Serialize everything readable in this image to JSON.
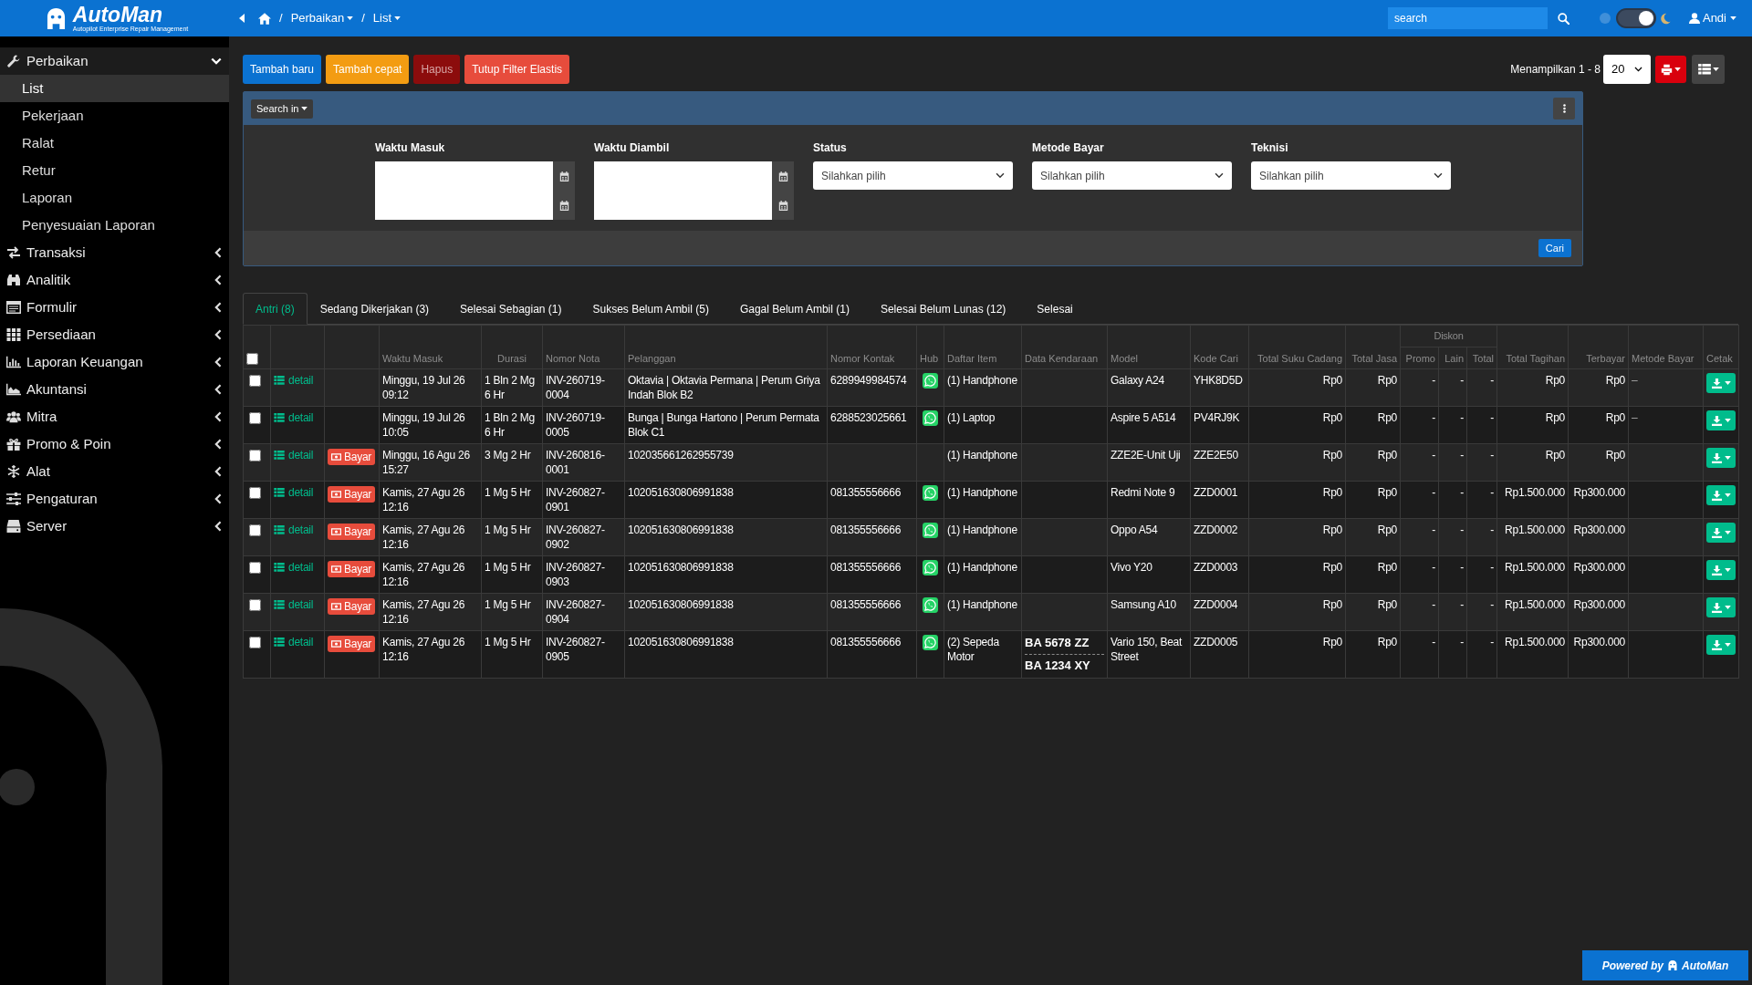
{
  "brand": {
    "name": "AutoMan",
    "tagline": "Autopilot Enterprise Repair Management"
  },
  "breadcrumb": [
    {
      "separator": "/",
      "label": "Perbaikan",
      "dropdown": true
    },
    {
      "separator": "/",
      "label": "List",
      "dropdown": true
    }
  ],
  "topbar": {
    "search": {
      "placeholder": "search"
    },
    "dark_mode": true,
    "user": "Andi"
  },
  "sidebar": {
    "items": [
      {
        "label": "Perbaikan",
        "expanded": true,
        "children": [
          {
            "label": "List",
            "selected": true
          },
          {
            "label": "Pekerjaan",
            "selected": false
          },
          {
            "label": "Ralat",
            "selected": false
          },
          {
            "label": "Retur",
            "selected": false
          },
          {
            "label": "Laporan",
            "selected": false
          },
          {
            "label": "Penyesuaian Laporan",
            "selected": false
          }
        ]
      },
      {
        "label": "Transaksi",
        "expanded": false
      },
      {
        "label": "Analitik",
        "expanded": false
      },
      {
        "label": "Formulir",
        "expanded": false
      },
      {
        "label": "Persediaan",
        "expanded": false
      },
      {
        "label": "Laporan Keuangan",
        "expanded": false
      },
      {
        "label": "Akuntansi",
        "expanded": false
      },
      {
        "label": "Mitra",
        "expanded": false
      },
      {
        "label": "Promo & Poin",
        "expanded": false
      },
      {
        "label": "Alat",
        "expanded": false
      },
      {
        "label": "Pengaturan",
        "expanded": false
      },
      {
        "label": "Server",
        "expanded": false
      }
    ]
  },
  "toolbar": {
    "buttons": [
      {
        "label": "Tambah baru",
        "kind": "primary",
        "disabled": false
      },
      {
        "label": "Tambah cepat",
        "kind": "warning",
        "disabled": false
      },
      {
        "label": "Hapus",
        "kind": "danger",
        "disabled": true
      },
      {
        "label": "Tutup Filter Elastis",
        "kind": "danger",
        "disabled": false
      }
    ],
    "summary": "Menampilkan 1 - 8",
    "page_size": "20"
  },
  "filter": {
    "search_in": "Search in",
    "fields": [
      {
        "label": "Waktu Masuk",
        "kind": "daterange"
      },
      {
        "label": "Waktu Diambil",
        "kind": "daterange"
      },
      {
        "label": "Status",
        "kind": "select",
        "placeholder": "Silahkan pilih"
      },
      {
        "label": "Metode Bayar",
        "kind": "select",
        "placeholder": "Silahkan pilih"
      },
      {
        "label": "Teknisi",
        "kind": "select",
        "placeholder": "Silahkan pilih"
      }
    ],
    "submit": "Cari"
  },
  "tabs": [
    {
      "label": "Antri (8)",
      "selected": true
    },
    {
      "label": "Sedang Dikerjakan (3)",
      "selected": false
    },
    {
      "label": "Selesai Sebagian (1)",
      "selected": false
    },
    {
      "label": "Sukses Belum Ambil (5)",
      "selected": false
    },
    {
      "label": "Gagal Belum Ambil (1)",
      "selected": false
    },
    {
      "label": "Selesai Belum Lunas (12)",
      "selected": false
    },
    {
      "label": "Selesai",
      "selected": false
    }
  ],
  "table": {
    "select_all": false,
    "columns": [
      {
        "label": "Waktu Masuk"
      },
      {
        "label": "Durasi"
      },
      {
        "label": "Nomor Nota"
      },
      {
        "label": "Pelanggan"
      },
      {
        "label": "Nomor Kontak"
      },
      {
        "label": "Hub"
      },
      {
        "label": "Daftar Item"
      },
      {
        "label": "Data Kendaraan"
      },
      {
        "label": "Model"
      },
      {
        "label": "Kode Cari"
      },
      {
        "label": "Total Suku Cadang"
      },
      {
        "label": "Total Jasa"
      },
      {
        "label": "Diskon",
        "children": [
          {
            "label": "Promo"
          },
          {
            "label": "Lain"
          },
          {
            "label": "Total"
          }
        ]
      },
      {
        "label": "Total Tagihan"
      },
      {
        "label": "Terbayar"
      },
      {
        "label": "Metode Bayar"
      },
      {
        "label": "Cetak"
      }
    ],
    "rows": [
      {
        "selected": false,
        "detail": "detail",
        "masuk": "Minggu, 19 Jul 26 09:12",
        "durasi": "1 Bln 2 Mg 6 Hr",
        "nota": "INV-260719-0004",
        "pelanggan": "Oktavia | Oktavia Permana | Perum Griya Indah Blok B2",
        "kontak": "6289949984574",
        "whatsapp": true,
        "items": "(1) Handphone",
        "model": "Galaxy A24",
        "kode": "YHK8D5D",
        "suku": "Rp0",
        "jasa": "Rp0",
        "promo": "-",
        "lain": "-",
        "diskon_total": "-",
        "tagihan": "Rp0",
        "terbayar": "Rp0",
        "metode": "–"
      },
      {
        "selected": false,
        "detail": "detail",
        "masuk": "Minggu, 19 Jul 26 10:05",
        "durasi": "1 Bln 2 Mg 6 Hr",
        "nota": "INV-260719-0005",
        "pelanggan": "Bunga | Bunga Hartono | Perum Permata Blok C1",
        "kontak": "6288523025661",
        "whatsapp": true,
        "items": "(1) Laptop",
        "model": "Aspire 5 A514",
        "kode": "PV4RJ9K",
        "suku": "Rp0",
        "jasa": "Rp0",
        "promo": "-",
        "lain": "-",
        "diskon_total": "-",
        "tagihan": "Rp0",
        "terbayar": "Rp0",
        "metode": "–"
      },
      {
        "selected": false,
        "detail": "detail",
        "pay": "Bayar",
        "masuk": "Minggu, 16 Agu 26 15:27",
        "durasi": "3 Mg 2 Hr",
        "nota": "INV-260816-0001",
        "pelanggan": "102035661262955739",
        "whatsapp": false,
        "items": "(1) Handphone",
        "model": "ZZE2E-Unit Uji",
        "kode": "ZZE2E50",
        "suku": "Rp0",
        "jasa": "Rp0",
        "promo": "-",
        "lain": "-",
        "diskon_total": "-",
        "tagihan": "Rp0",
        "terbayar": "Rp0"
      },
      {
        "selected": false,
        "detail": "detail",
        "pay": "Bayar",
        "masuk": "Kamis, 27 Agu 26 12:16",
        "durasi": "1 Mg 5 Hr",
        "nota": "INV-260827-0901",
        "pelanggan": "102051630806991838",
        "kontak": "081355556666",
        "whatsapp": true,
        "items": "(1) Handphone",
        "model": "Redmi Note 9",
        "kode": "ZZD0001",
        "suku": "Rp0",
        "jasa": "Rp0",
        "promo": "-",
        "lain": "-",
        "diskon_total": "-",
        "tagihan": "Rp1.500.000",
        "terbayar": "Rp300.000"
      },
      {
        "selected": false,
        "detail": "detail",
        "pay": "Bayar",
        "masuk": "Kamis, 27 Agu 26 12:16",
        "durasi": "1 Mg 5 Hr",
        "nota": "INV-260827-0902",
        "pelanggan": "102051630806991838",
        "kontak": "081355556666",
        "whatsapp": true,
        "items": "(1) Handphone",
        "model": "Oppo A54",
        "kode": "ZZD0002",
        "suku": "Rp0",
        "jasa": "Rp0",
        "promo": "-",
        "lain": "-",
        "diskon_total": "-",
        "tagihan": "Rp1.500.000",
        "terbayar": "Rp300.000"
      },
      {
        "selected": false,
        "detail": "detail",
        "pay": "Bayar",
        "masuk": "Kamis, 27 Agu 26 12:16",
        "durasi": "1 Mg 5 Hr",
        "nota": "INV-260827-0903",
        "pelanggan": "102051630806991838",
        "kontak": "081355556666",
        "whatsapp": true,
        "items": "(1) Handphone",
        "model": "Vivo Y20",
        "kode": "ZZD0003",
        "suku": "Rp0",
        "jasa": "Rp0",
        "promo": "-",
        "lain": "-",
        "diskon_total": "-",
        "tagihan": "Rp1.500.000",
        "terbayar": "Rp300.000"
      },
      {
        "selected": false,
        "detail": "detail",
        "pay": "Bayar",
        "masuk": "Kamis, 27 Agu 26 12:16",
        "durasi": "1 Mg 5 Hr",
        "nota": "INV-260827-0904",
        "pelanggan": "102051630806991838",
        "kontak": "081355556666",
        "whatsapp": true,
        "items": "(1) Handphone",
        "model": "Samsung A10",
        "kode": "ZZD0004",
        "suku": "Rp0",
        "jasa": "Rp0",
        "promo": "-",
        "lain": "-",
        "diskon_total": "-",
        "tagihan": "Rp1.500.000",
        "terbayar": "Rp300.000"
      },
      {
        "selected": false,
        "detail": "detail",
        "pay": "Bayar",
        "masuk": "Kamis, 27 Agu 26 12:16",
        "durasi": "1 Mg 5 Hr",
        "nota": "INV-260827-0905",
        "pelanggan": "102051630806991838",
        "kontak": "081355556666",
        "whatsapp": true,
        "items": "(2) Sepeda Motor",
        "kendaraan": [
          "BA 5678 ZZ",
          "BA 1234 XY"
        ],
        "model": "Vario 150, Beat Street",
        "kode": "ZZD0005",
        "suku": "Rp0",
        "jasa": "Rp0",
        "promo": "-",
        "lain": "-",
        "diskon_total": "-",
        "tagihan": "Rp1.500.000",
        "terbayar": "Rp300.000"
      }
    ]
  },
  "footer": {
    "powered_by": "Powered by",
    "brand": "AutoMan"
  }
}
